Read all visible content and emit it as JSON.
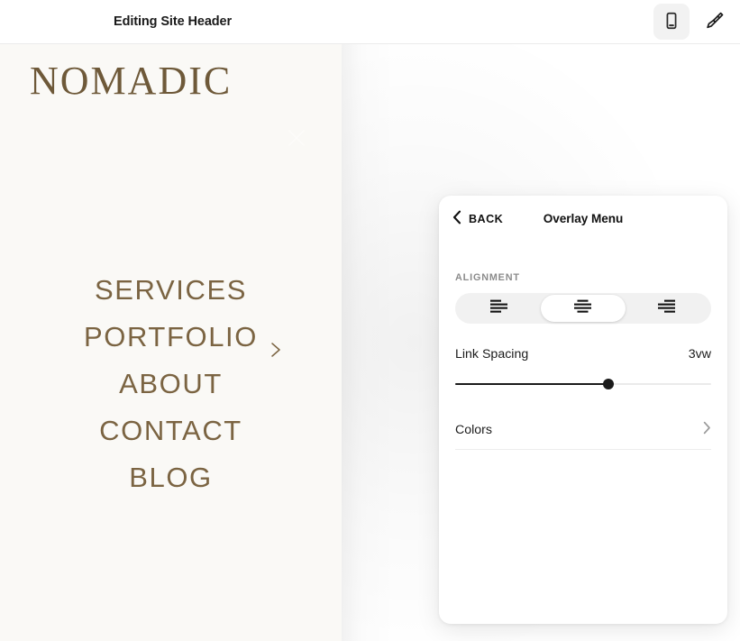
{
  "topbar": {
    "title": "Editing Site Header",
    "actions": [
      {
        "name": "mobile-preview-toggle",
        "icon": "mobile-icon",
        "active": true
      },
      {
        "name": "style-brush-button",
        "icon": "paintbrush-icon",
        "active": false
      }
    ]
  },
  "preview": {
    "brand": "NOMADIC",
    "close_icon": "close-icon",
    "background_color": "#faf9f6",
    "link_color": "#7b6442",
    "brand_color": "#6e5939",
    "nav_links": [
      {
        "label": "SERVICES",
        "has_submenu": false
      },
      {
        "label": "PORTFOLIO",
        "has_submenu": true
      },
      {
        "label": "ABOUT",
        "has_submenu": false
      },
      {
        "label": "CONTACT",
        "has_submenu": false
      },
      {
        "label": "BLOG",
        "has_submenu": false
      }
    ]
  },
  "panel": {
    "back_label": "BACK",
    "back_icon": "chevron-left-icon",
    "title": "Overlay Menu",
    "alignment": {
      "label": "ALIGNMENT",
      "options": [
        {
          "value": "left",
          "icon": "align-left-icon"
        },
        {
          "value": "center",
          "icon": "align-center-icon"
        },
        {
          "value": "right",
          "icon": "align-right-icon"
        }
      ],
      "selected": "center"
    },
    "link_spacing": {
      "label": "Link Spacing",
      "value": "3vw",
      "percent": 60
    },
    "colors": {
      "label": "Colors",
      "chevron_icon": "chevron-right-icon"
    }
  }
}
